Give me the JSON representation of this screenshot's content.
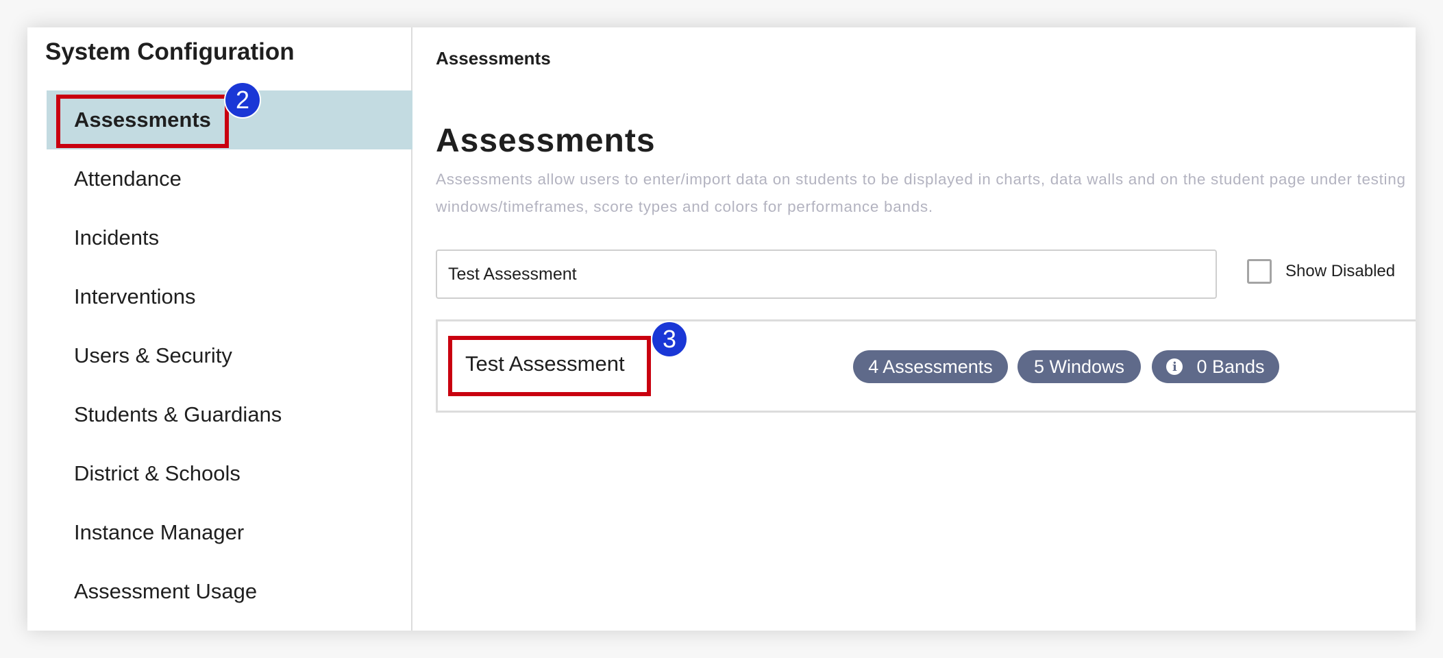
{
  "sidebar": {
    "title": "System Configuration",
    "items": [
      {
        "label": "Assessments",
        "active": true
      },
      {
        "label": "Attendance"
      },
      {
        "label": "Incidents"
      },
      {
        "label": "Interventions"
      },
      {
        "label": "Users & Security"
      },
      {
        "label": "Students & Guardians"
      },
      {
        "label": "District & Schools"
      },
      {
        "label": "Instance Manager"
      },
      {
        "label": "Assessment Usage"
      }
    ]
  },
  "main": {
    "breadcrumb": "Assessments",
    "title": "Assessments",
    "description": "Assessments allow users to enter/import data on students to be displayed in charts, data walls and on the student page under testing windows/timeframes, score types and colors for performance bands.",
    "search": {
      "value": "Test Assessment",
      "placeholder": ""
    },
    "show_disabled": {
      "label": "Show Disabled",
      "checked": false
    },
    "results": [
      {
        "name": "Test Assessment",
        "badges": {
          "assessments": "4 Assessments",
          "windows": "5 Windows",
          "bands": "0 Bands"
        }
      }
    ]
  },
  "annotations": {
    "step_2": "2",
    "step_3": "3"
  },
  "icons": {
    "bands_badge_icon": "info-icon"
  },
  "colors": {
    "active_nav_bg": "#c3dbe1",
    "badge_bg": "#5f6a8a",
    "highlight_border": "#c9000f",
    "step_badge_bg": "#1a37d6"
  }
}
